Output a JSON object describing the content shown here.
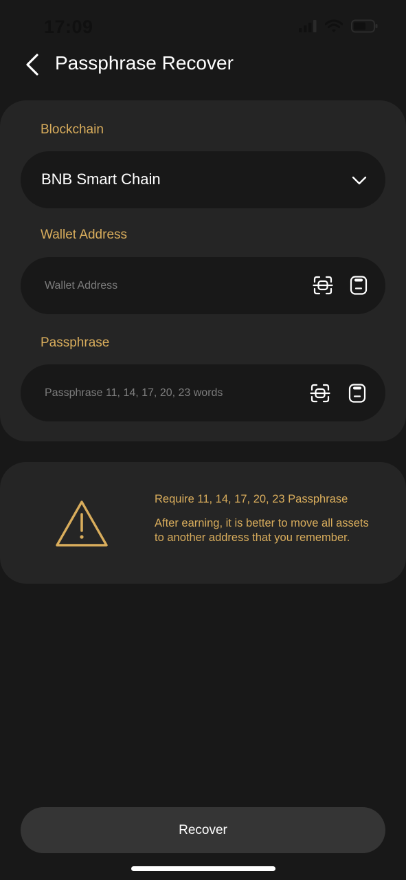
{
  "status_bar": {
    "time": "17:09",
    "icons": [
      "cellular-signal-icon",
      "wifi-icon",
      "battery-icon"
    ]
  },
  "header": {
    "back_icon": "chevron-left-icon",
    "title": "Passphrase Recover"
  },
  "form": {
    "blockchain": {
      "label": "Blockchain",
      "selected_value": "BNB Smart Chain",
      "icon": "chevron-down-icon"
    },
    "wallet_address": {
      "label": "Wallet Address",
      "value": "",
      "placeholder": "Wallet Address",
      "scan_icon": "scan-icon",
      "paste_icon": "clipboard-icon"
    },
    "passphrase": {
      "label": "Passphrase",
      "value": "",
      "placeholder": "Passphrase 11, 14, 17, 20, 23 words",
      "scan_icon": "scan-icon",
      "paste_icon": "clipboard-icon"
    }
  },
  "notice": {
    "icon": "warning-triangle-icon",
    "title": "Require 11, 14, 17, 20, 23 Passphrase",
    "body": "After earning, it is better to move all assets to another address that you remember."
  },
  "actions": {
    "recover_label": "Recover"
  },
  "colors": {
    "background": "#181818",
    "card": "#252525",
    "accent_gold": "#d9ad5c",
    "button": "#353535"
  }
}
